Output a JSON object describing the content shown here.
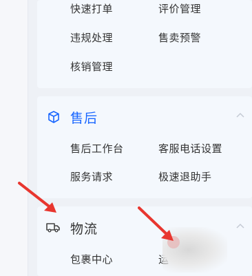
{
  "top_section": {
    "items": [
      "快速打单",
      "评价管理",
      "违规处理",
      "售卖预警",
      "核销管理"
    ]
  },
  "aftersale": {
    "title": "售后",
    "icon": "cube-icon",
    "accent": "#1966ff",
    "items": [
      "售后工作台",
      "客服电话设置",
      "服务请求",
      "极速退助手"
    ]
  },
  "logistics": {
    "title": "物流",
    "icon": "truck-icon",
    "items": [
      "包裹中心",
      "运"
    ]
  },
  "colors": {
    "annotation_arrow": "#e8362f",
    "card_bg": "#f4f8fd",
    "text": "#333333"
  }
}
